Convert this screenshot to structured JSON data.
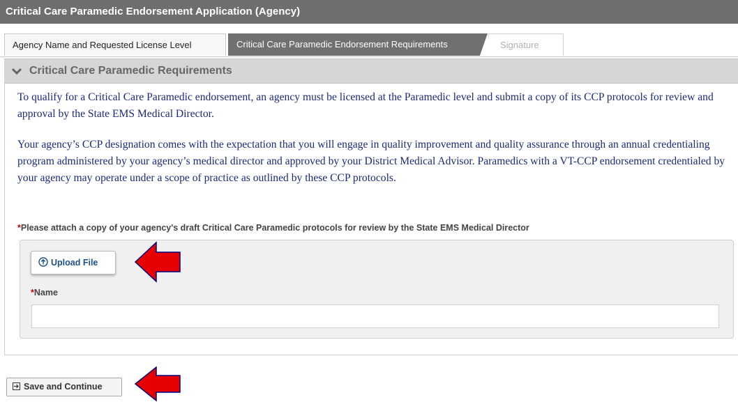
{
  "window": {
    "title": "Critical Care Paramedic Endorsement Application (Agency)"
  },
  "tabs": [
    {
      "label": "Agency Name and Requested License Level",
      "state": "completed"
    },
    {
      "label": "Critical Care Paramedic Endorsement Requirements",
      "state": "active"
    },
    {
      "label": "Signature",
      "state": "disabled"
    }
  ],
  "section": {
    "title": "Critical Care Paramedic Requirements",
    "icon": "chevron-down-icon",
    "paragraphs": [
      "To qualify for a Critical Care Paramedic endorsement, an agency must be licensed at the Paramedic level and submit a copy of its CCP protocols for review and approval by the State EMS Medical Director.",
      "Your agency’s CCP designation comes with the expectation that you will engage in quality improvement and quality assurance through an annual credentialing program administered by your agency’s medical director and approved by your District Medical Advisor. Paramedics with a VT-CCP endorsement credentialed by your agency may operate under a scope of practice as outlined by these CCP protocols."
    ]
  },
  "attachment": {
    "required_marker": "*",
    "instruction": "Please attach a copy of your agency's draft Critical Care Paramedic protocols for review by the State EMS Medical Director",
    "upload_label": "Upload File",
    "upload_icon": "upload-circle-icon",
    "name_label": "Name",
    "name_value": "",
    "name_placeholder": ""
  },
  "footer": {
    "save_label": "Save and Continue",
    "save_icon": "arrow-right-box-icon"
  },
  "colors": {
    "title_bar": "#6e6e6e",
    "active_tab": "#707070",
    "body_text": "#1b2a7a",
    "required": "#c00000",
    "annotation_arrow": "#e60000"
  }
}
